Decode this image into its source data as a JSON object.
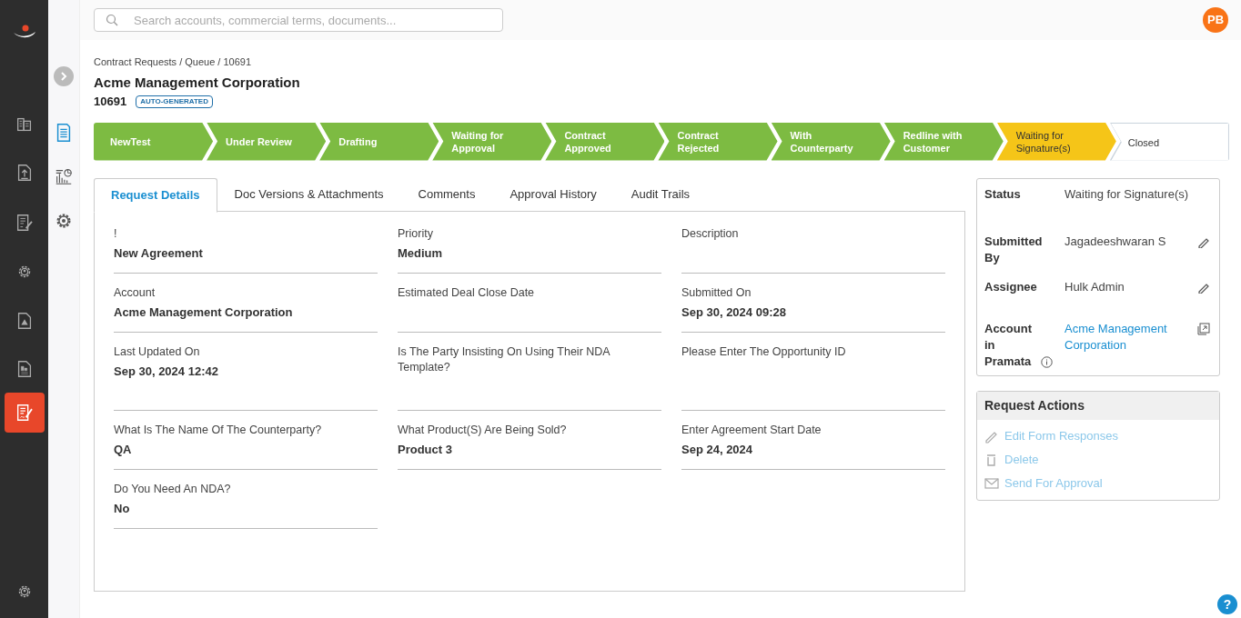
{
  "search": {
    "placeholder": "Search accounts, commercial terms, documents..."
  },
  "avatar": {
    "initials": "PB"
  },
  "breadcrumb": "Contract Requests / Queue / 10691",
  "title": "Acme Management Corporation",
  "request_id": "10691",
  "badge": "AUTO-GENERATED",
  "side_rail": [
    {
      "kind": "buildings",
      "selected": false
    },
    {
      "kind": "upload",
      "selected": false
    },
    {
      "kind": "doc-edit",
      "selected": false
    },
    {
      "kind": "gear",
      "selected": false
    },
    {
      "kind": "doc-warning",
      "selected": false
    },
    {
      "kind": "doc-chart",
      "selected": false
    },
    {
      "kind": "contract",
      "selected": true
    }
  ],
  "sub_rail": [
    {
      "kind": "document",
      "selected": true
    },
    {
      "kind": "report",
      "selected": false
    },
    {
      "kind": "settings",
      "selected": false
    }
  ],
  "stages": [
    {
      "label": "NewTest",
      "kind": "done"
    },
    {
      "label": "Under Review",
      "kind": "done"
    },
    {
      "label": "Drafting",
      "kind": "done"
    },
    {
      "label": "Waiting for Approval",
      "kind": "done"
    },
    {
      "label": "Contract Approved",
      "kind": "done"
    },
    {
      "label": "Contract Rejected",
      "kind": "done"
    },
    {
      "label": "With Counterparty",
      "kind": "done"
    },
    {
      "label": "Redline with Customer",
      "kind": "done"
    },
    {
      "label": "Waiting for Signature(s)",
      "kind": "current"
    },
    {
      "label": "Closed",
      "kind": "pending"
    }
  ],
  "tabs": [
    {
      "label": "Request Details",
      "selected": true
    },
    {
      "label": "Doc Versions & Attachments",
      "selected": false
    },
    {
      "label": "Comments",
      "selected": false
    },
    {
      "label": "Approval History",
      "selected": false
    },
    {
      "label": "Audit Trails",
      "selected": false
    }
  ],
  "fields": [
    {
      "label": "!",
      "value": "New Agreement"
    },
    {
      "label": "Priority",
      "value": "Medium"
    },
    {
      "label": "Description"
    },
    {
      "label": "Account",
      "value": "Acme Management Corporation"
    },
    {
      "label": "Estimated Deal Close Date"
    },
    {
      "label": "Submitted On",
      "value": "Sep 30, 2024 09:28"
    },
    {
      "label": "Last Updated On",
      "value": "Sep 30, 2024 12:42"
    },
    {
      "label": "Is The Party Insisting On Using Their NDA Template?"
    },
    {
      "label": "Please Enter The Opportunity ID"
    },
    {
      "label": "What Is The Name Of The Counterparty?",
      "value": "QA"
    },
    {
      "label": "What Product(S) Are Being Sold?",
      "value": "Product 3"
    },
    {
      "label": "Enter Agreement Start Date",
      "value": "Sep 24, 2024"
    },
    {
      "label": "Do You Need An NDA?",
      "value": "No"
    }
  ],
  "summary": [
    {
      "label": "Status",
      "value": "Waiting for Signature(s)",
      "kind": "text"
    },
    {
      "label": "Submitted By",
      "value": "Jagadeeshwaran S",
      "kind": "editable"
    },
    {
      "label": "Assignee",
      "value": "Hulk Admin",
      "kind": "editable"
    },
    {
      "label": "Account in Pramata",
      "value": "Acme Management Corporation",
      "kind": "link",
      "info": true
    }
  ],
  "actions": {
    "title": "Request Actions",
    "items": [
      {
        "label": "Edit Form Responses",
        "kind": "edit"
      },
      {
        "label": "Delete",
        "kind": "delete"
      },
      {
        "label": "Send For Approval",
        "kind": "mail"
      }
    ]
  },
  "help": "?"
}
